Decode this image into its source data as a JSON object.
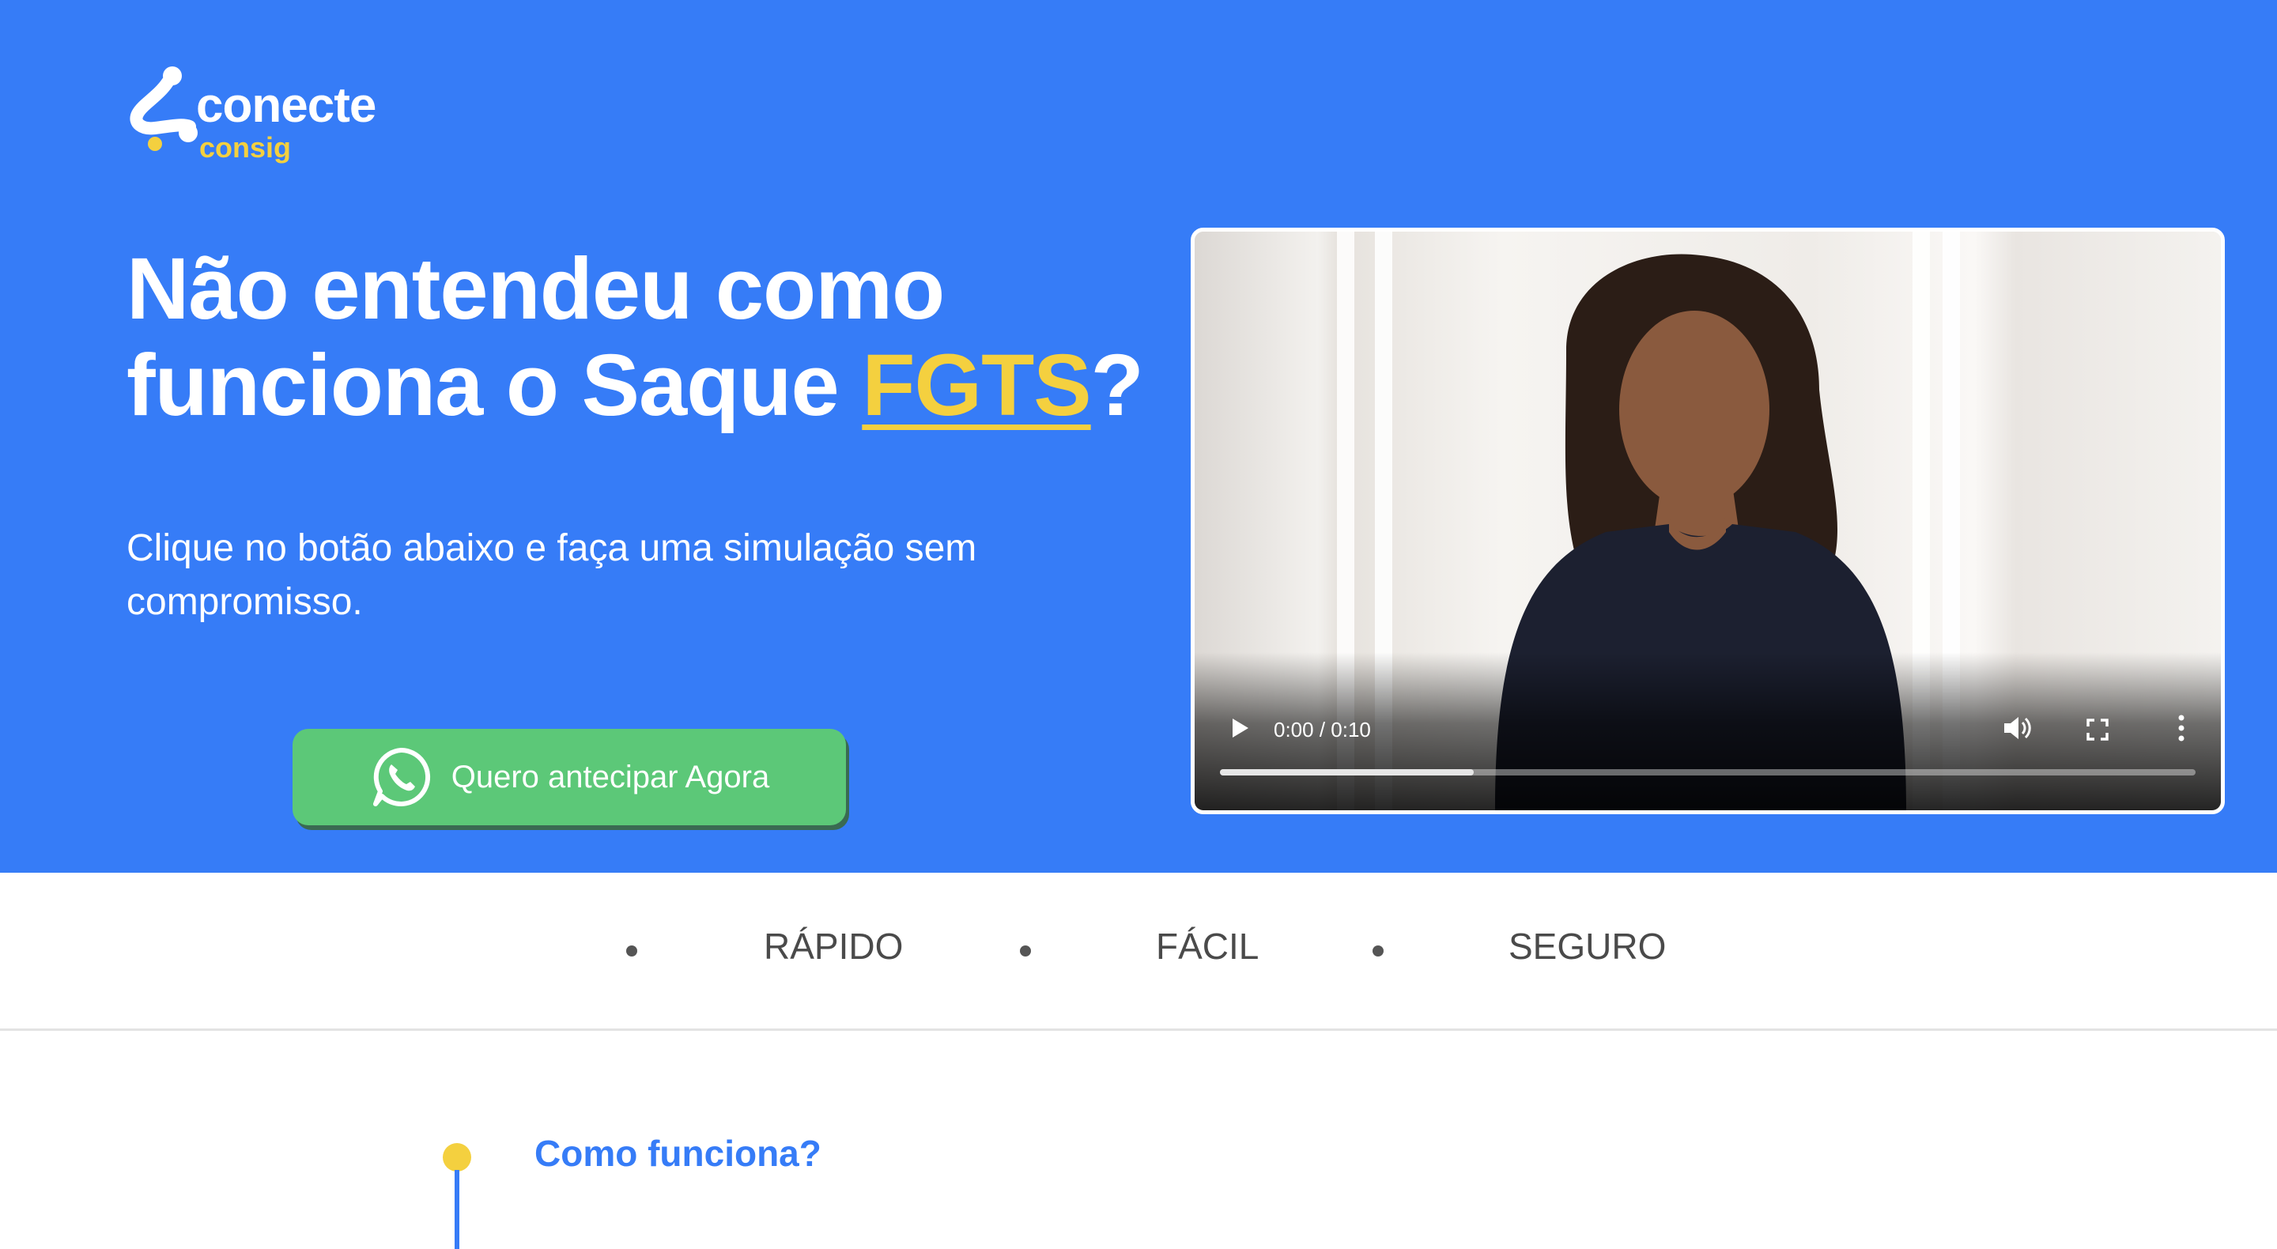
{
  "colors": {
    "hero_bg": "#367cf7",
    "accent_yellow": "#f4d03f",
    "cta_green": "#5cc878",
    "feature_text": "#4a4a4a"
  },
  "logo": {
    "name": "conecte",
    "sub": "consig"
  },
  "hero": {
    "headline_part1": "Não entendeu como funciona o Saque ",
    "headline_accent": "FGTS",
    "headline_part2": "?",
    "subtext": "Clique no botão abaixo e faça uma simulação sem compromisso.",
    "cta_label": "Quero antecipar Agora",
    "cta_icon": "whatsapp-icon"
  },
  "video": {
    "time": "0:00 / 0:10",
    "progress": 0.26,
    "icons": [
      "play-icon",
      "volume-icon",
      "fullscreen-icon",
      "more-options-icon"
    ]
  },
  "features": {
    "items": [
      "RÁPIDO",
      "FÁCIL",
      "SEGURO"
    ]
  },
  "steps": {
    "title": "Como funciona?"
  }
}
